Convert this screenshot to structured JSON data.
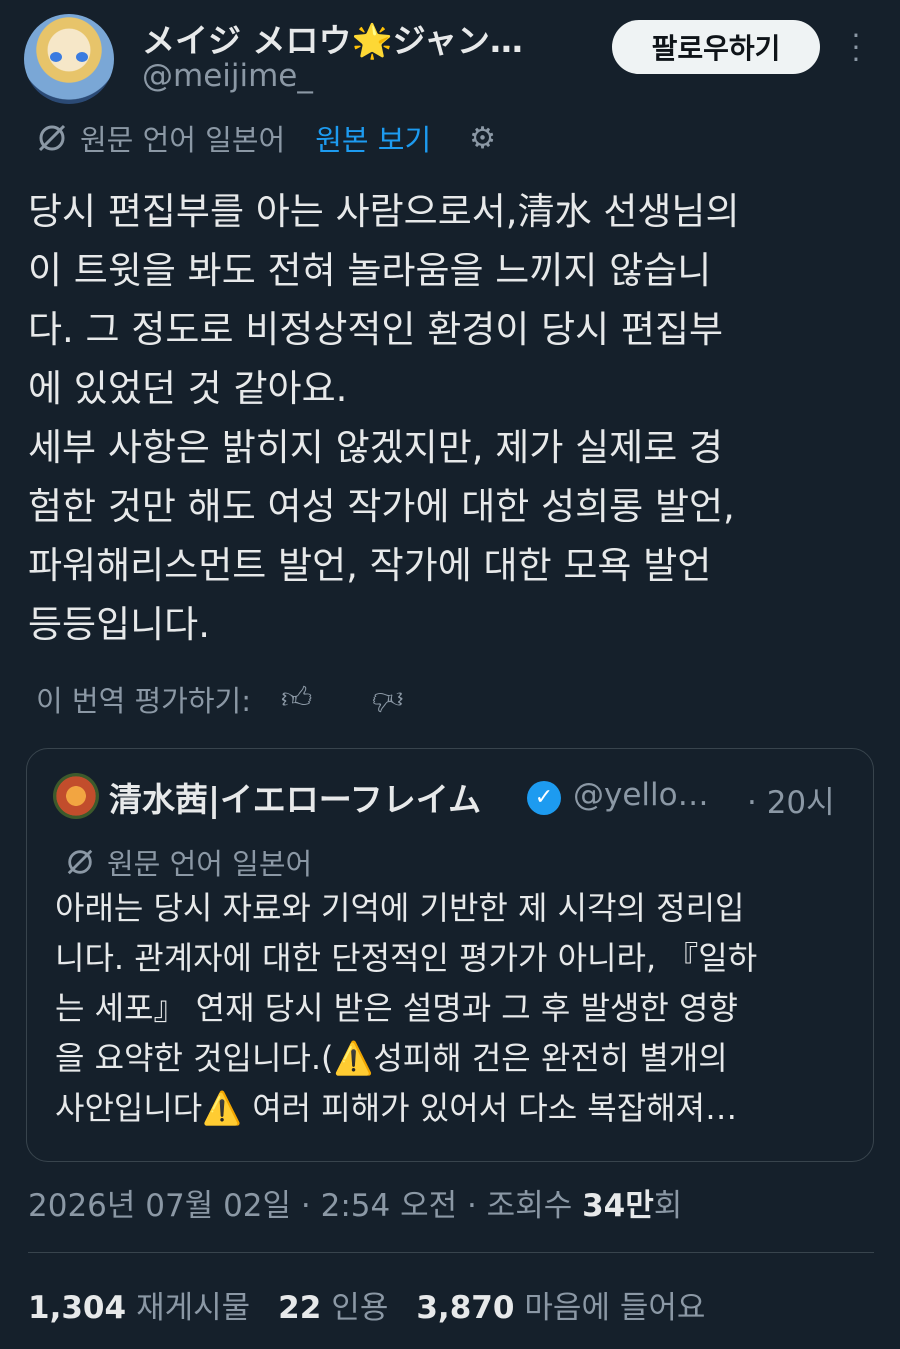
{
  "author": {
    "display_name": "メイジ メロウ🌟ジャン…",
    "handle": "@meijime_"
  },
  "follow_label": "팔로우하기",
  "translation": {
    "source_language": "원문 언어 일본어",
    "show_original": "원본 보기"
  },
  "tweet_text": "당시 편집부를 아는 사람으로서,清水 선생님의\n이 트윗을 봐도 전혀 놀라움을 느끼지 않습니\n다. 그 정도로 비정상적인 환경이 당시 편집부\n에 있었던 것 같아요.\n세부 사항은 밝히지 않겠지만, 제가 실제로 경\n험한 것만 해도 여성 작가에 대한 성희롱 발언,\n파워해리스먼트 발언, 작가에 대한 모욕 발언\n등등입니다.",
  "rate_label": "이 번역 평가하기:",
  "quote": {
    "display_name": "清水茜|イエローフレイム",
    "handle": "@yello…",
    "time": "· 20시",
    "source_language": "원문 언어 일본어",
    "text": "아래는 당시 자료와 기억에 기반한 제 시각의 정리입\n니다. 관계자에 대한 단정적인 평가가 아니라, 『일하\n는 세포』 연재 당시 받은 설명과 그 후 발생한 영향\n을 요약한 것입니다.(⚠️성피해 건은 완전히 별개의\n사안입니다⚠️ 여러 피해가 있어서 다소 복잡해져…"
  },
  "meta": {
    "date_time": "2026년 07월 02일 · 2:54 오전 · 조회수 ",
    "views": "34만",
    "views_suffix": "회"
  },
  "stats": {
    "retweets": "1,304",
    "retweets_label": "재게시물",
    "quotes": "22",
    "quotes_label": "인용",
    "likes": "3,870",
    "likes_label": "마음에 들어요"
  },
  "icons": {
    "translate": "translate-icon",
    "settings": "gear-icon",
    "thumb_up": "thumbs-up-icon",
    "thumb_down": "thumbs-down-icon",
    "more": "more-vertical-icon",
    "verified": "verified-badge-icon"
  },
  "colors": {
    "background": "#15202b",
    "accent": "#1d9bf0",
    "secondary_text": "#8b98a5"
  }
}
